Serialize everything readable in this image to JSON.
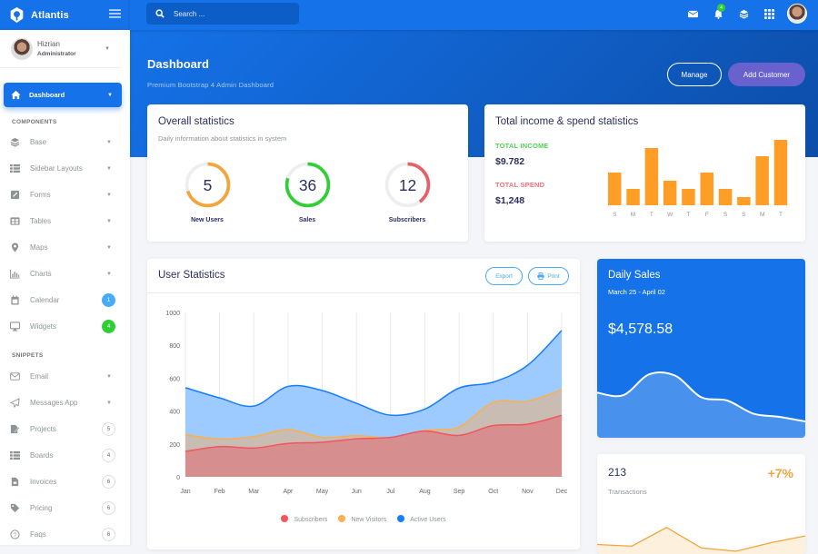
{
  "app": {
    "name": "Atlantis"
  },
  "search": {
    "placeholder": "Search ..."
  },
  "topbar": {
    "notification_count": "4"
  },
  "user": {
    "name": "Hizrian",
    "role": "Administrator"
  },
  "sidebar": {
    "active": "Dashboard",
    "components_label": "COMPONENTS",
    "components": [
      {
        "label": "Base",
        "icon": "layers-icon",
        "caret": true
      },
      {
        "label": "Sidebar Layouts",
        "icon": "th-list-icon",
        "caret": true
      },
      {
        "label": "Forms",
        "icon": "pen-square-icon",
        "caret": true
      },
      {
        "label": "Tables",
        "icon": "table-icon",
        "caret": true
      },
      {
        "label": "Maps",
        "icon": "map-marker-icon",
        "caret": true
      },
      {
        "label": "Charts",
        "icon": "chart-bar-icon",
        "caret": true
      },
      {
        "label": "Calendar",
        "icon": "calendar-icon",
        "badge": "1",
        "badge_style": "blue"
      },
      {
        "label": "Widgets",
        "icon": "desktop-icon",
        "badge": "4",
        "badge_style": "green"
      }
    ],
    "snippets_label": "SNIPPETS",
    "snippets": [
      {
        "label": "Email",
        "icon": "envelope-icon",
        "caret": true
      },
      {
        "label": "Messages App",
        "icon": "paper-plane-icon",
        "caret": true
      },
      {
        "label": "Projects",
        "icon": "file-signature-icon",
        "badge": "5",
        "badge_style": "count"
      },
      {
        "label": "Boards",
        "icon": "th-list-icon",
        "badge": "4",
        "badge_style": "count"
      },
      {
        "label": "Invoices",
        "icon": "file-invoice-icon",
        "badge": "6",
        "badge_style": "count"
      },
      {
        "label": "Pricing",
        "icon": "tag-icon",
        "badge": "6",
        "badge_style": "count"
      },
      {
        "label": "Faqs",
        "icon": "question-circle-icon",
        "badge": "6",
        "badge_style": "count"
      }
    ]
  },
  "header": {
    "title": "Dashboard",
    "subtitle": "Premium Bootstrap 4 Admin Dashboard",
    "manage_label": "Manage",
    "add_customer_label": "Add Customer"
  },
  "overall": {
    "title": "Overall statistics",
    "subtitle": "Daily information about statistics in system",
    "items": [
      {
        "value": "5",
        "label": "New Users",
        "fraction": 0.7,
        "color": "#f3a43b"
      },
      {
        "value": "36",
        "label": "Sales",
        "fraction": 0.8,
        "color": "#31ce36"
      },
      {
        "value": "12",
        "label": "Subscribers",
        "fraction": 0.4,
        "color": "#e95f69"
      }
    ]
  },
  "income": {
    "title": "Total income & spend statistics",
    "income_label": "TOTAL INCOME",
    "income_value": "$9.782",
    "spend_label": "TOTAL SPEND",
    "spend_value": "$1,248",
    "colors": {
      "income": "#31ce36",
      "spend": "#f25961",
      "bar": "#ff9e27"
    }
  },
  "user_stats": {
    "title": "User Statistics",
    "export_label": "Export",
    "print_label": "Print"
  },
  "daily_sales": {
    "title": "Daily Sales",
    "range": "March 25 - April 02",
    "amount": "$4,578.58"
  },
  "transactions": {
    "value": "213",
    "label": "Transactions",
    "change": "+7%"
  },
  "chart_data": [
    {
      "type": "bar",
      "title": "Total income & spend statistics",
      "categories": [
        "S",
        "M",
        "T",
        "W",
        "T",
        "F",
        "S",
        "S",
        "M",
        "T"
      ],
      "values": [
        4,
        2,
        7,
        3,
        2,
        4,
        2,
        1,
        6,
        8
      ],
      "ylim": [
        0,
        8
      ]
    },
    {
      "type": "area",
      "title": "User Statistics",
      "x": [
        "Jan",
        "Feb",
        "Mar",
        "Apr",
        "May",
        "Jun",
        "Jul",
        "Aug",
        "Sep",
        "Oct",
        "Nov",
        "Dec"
      ],
      "ylim": [
        0,
        1000
      ],
      "yticks": [
        0,
        200,
        400,
        600,
        800,
        1000
      ],
      "grid": true,
      "legend": "bottom",
      "series": [
        {
          "name": "Subscribers",
          "color": "#f3545d",
          "values": [
            154,
            184,
            175,
            203,
            210,
            231,
            240,
            278,
            252,
            312,
            320,
            374
          ]
        },
        {
          "name": "New Visitors",
          "color": "#fdaf4b",
          "values": [
            256,
            230,
            245,
            287,
            240,
            250,
            238,
            282,
            303,
            453,
            460,
            530
          ]
        },
        {
          "name": "Active Users",
          "color": "#177dff",
          "values": [
            542,
            480,
            430,
            550,
            525,
            447,
            375,
            412,
            540,
            576,
            678,
            890
          ]
        }
      ]
    },
    {
      "type": "area",
      "title": "Daily Sales",
      "values": [
        62,
        58,
        90,
        88,
        55,
        50,
        30,
        25,
        18
      ]
    },
    {
      "type": "line",
      "title": "Transactions",
      "values": [
        20,
        15,
        70,
        10,
        0,
        25,
        45
      ]
    }
  ]
}
